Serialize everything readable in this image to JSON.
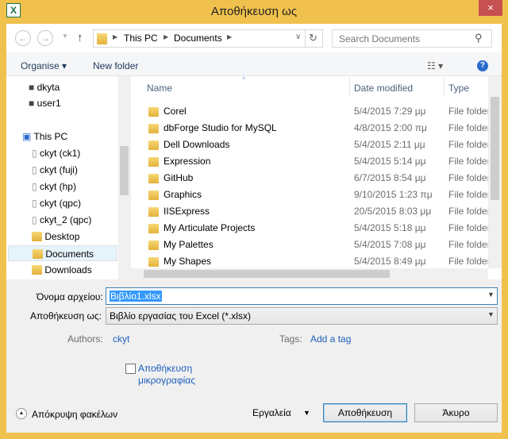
{
  "window": {
    "title": "Αποθήκευση ως",
    "close": "×",
    "app_icon": "excel-icon"
  },
  "nav": {
    "back": "←",
    "forward": "→",
    "up": "↑",
    "breadcrumb": [
      "This PC",
      "Documents"
    ],
    "search_placeholder": "Search Documents"
  },
  "commandbar": {
    "organise": "Organise ▾",
    "new_folder": "New folder",
    "view": "☷ ▾",
    "help": "?"
  },
  "sidebar": {
    "items": [
      {
        "label": "dkyta",
        "icon": "user-icon"
      },
      {
        "label": "user1",
        "icon": "user-icon"
      },
      {
        "label": "This PC",
        "icon": "computer-icon"
      },
      {
        "label": "ckyt (ck1)",
        "icon": "network-drive-icon"
      },
      {
        "label": "ckyt (fuji)",
        "icon": "network-drive-icon"
      },
      {
        "label": "ckyt (hp)",
        "icon": "network-drive-icon"
      },
      {
        "label": "ckyt (qpc)",
        "icon": "network-drive-icon"
      },
      {
        "label": "ckyt_2 (qpc)",
        "icon": "network-drive-icon"
      },
      {
        "label": "Desktop",
        "icon": "desktop-icon"
      },
      {
        "label": "Documents",
        "icon": "documents-icon",
        "selected": true
      },
      {
        "label": "Downloads",
        "icon": "downloads-icon"
      }
    ]
  },
  "list": {
    "columns": [
      "Name",
      "Date modified",
      "Type"
    ],
    "rows": [
      {
        "name": "Corel",
        "date": "5/4/2015 7:29 μμ",
        "type": "File folder"
      },
      {
        "name": "dbForge Studio for MySQL",
        "date": "4/8/2015 2:00 πμ",
        "type": "File folder"
      },
      {
        "name": "Dell Downloads",
        "date": "5/4/2015 2:11 μμ",
        "type": "File folder"
      },
      {
        "name": "Expression",
        "date": "5/4/2015 5:14 μμ",
        "type": "File folder"
      },
      {
        "name": "GitHub",
        "date": "6/7/2015 8:54 μμ",
        "type": "File folder"
      },
      {
        "name": "Graphics",
        "date": "9/10/2015 1:23 πμ",
        "type": "File folder"
      },
      {
        "name": "IISExpress",
        "date": "20/5/2015 8:03 μμ",
        "type": "File folder"
      },
      {
        "name": "My Articulate Projects",
        "date": "5/4/2015 5:18 μμ",
        "type": "File folder"
      },
      {
        "name": "My Palettes",
        "date": "5/4/2015 7:08 μμ",
        "type": "File folder"
      },
      {
        "name": "My Shapes",
        "date": "5/4/2015 8:49 μμ",
        "type": "File folder"
      }
    ]
  },
  "form": {
    "filename_label": "Όνομα αρχείου:",
    "filename": "Βιβλίο1.xlsx",
    "savetype_label": "Αποθήκευση ως:",
    "savetype": "Βιβλίο εργασίας του Excel (*.xlsx)",
    "authors_label": "Authors:",
    "authors": "ckyt",
    "tags_label": "Tags:",
    "tags": "Add a tag",
    "thumbnail_line1": "Αποθήκευση",
    "thumbnail_line2": "μικρογραφίας",
    "thumbnail_checked": false
  },
  "footer": {
    "hide_folders": "Απόκρυψη φακέλων",
    "tools": "Εργαλεία",
    "save": "Αποθήκευση",
    "cancel": "Άκυρο"
  }
}
